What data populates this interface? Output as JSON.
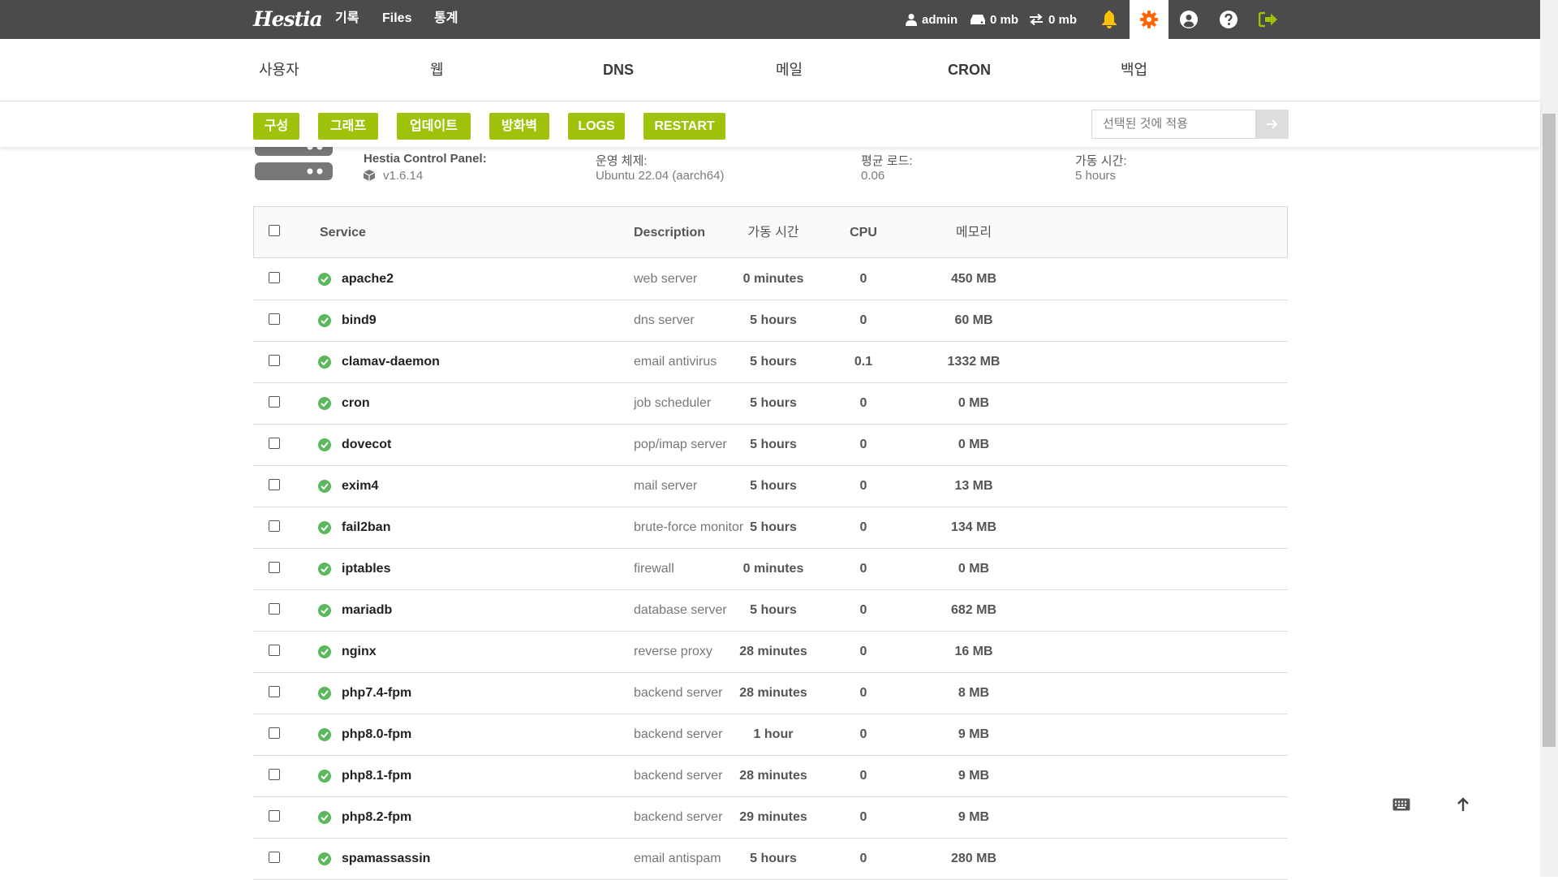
{
  "topbar": {
    "logo": "Hestia",
    "nav": [
      "기록",
      "Files",
      "통계"
    ],
    "user": "admin",
    "disk": "0 mb",
    "bandwidth": "0 mb",
    "colors": {
      "bar": "#4b4b4b",
      "bell": "#ffc107",
      "gear": "#ff6701",
      "logout": "#9ec30a"
    }
  },
  "mainnav": {
    "tabs": [
      "사용자",
      "웹",
      "DNS",
      "메일",
      "CRON",
      "백업"
    ]
  },
  "toolbar": {
    "buttons": [
      "구성",
      "그래프",
      "업데이트",
      "방화벽",
      "LOGS",
      "RESTART"
    ],
    "apply_placeholder": "선택된 것에 적용",
    "accent": "#9ec30a"
  },
  "server": {
    "panel_label": "Hestia Control Panel:",
    "panel_version": "v1.6.14",
    "os_label": "운영 체제:",
    "os_value": "Ubuntu 22.04 (aarch64)",
    "load_label": "평균 로드:",
    "load_value": "0.06",
    "uptime_label": "가동 시간:",
    "uptime_value": "5 hours"
  },
  "table": {
    "headers": {
      "service": "Service",
      "description": "Description",
      "uptime": "가동 시간",
      "cpu": "CPU",
      "memory": "메모리"
    },
    "rows": [
      {
        "name": "apache2",
        "desc": "web server",
        "uptime": "0 minutes",
        "cpu": "0",
        "mem": "450 MB"
      },
      {
        "name": "bind9",
        "desc": "dns server",
        "uptime": "5 hours",
        "cpu": "0",
        "mem": "60 MB"
      },
      {
        "name": "clamav-daemon",
        "desc": "email antivirus",
        "uptime": "5 hours",
        "cpu": "0.1",
        "mem": "1332 MB"
      },
      {
        "name": "cron",
        "desc": "job scheduler",
        "uptime": "5 hours",
        "cpu": "0",
        "mem": "0 MB"
      },
      {
        "name": "dovecot",
        "desc": "pop/imap server",
        "uptime": "5 hours",
        "cpu": "0",
        "mem": "0 MB"
      },
      {
        "name": "exim4",
        "desc": "mail server",
        "uptime": "5 hours",
        "cpu": "0",
        "mem": "13 MB"
      },
      {
        "name": "fail2ban",
        "desc": "brute-force monitor",
        "uptime": "5 hours",
        "cpu": "0",
        "mem": "134 MB"
      },
      {
        "name": "iptables",
        "desc": "firewall",
        "uptime": "0 minutes",
        "cpu": "0",
        "mem": "0 MB"
      },
      {
        "name": "mariadb",
        "desc": "database server",
        "uptime": "5 hours",
        "cpu": "0",
        "mem": "682 MB"
      },
      {
        "name": "nginx",
        "desc": "reverse proxy",
        "uptime": "28 minutes",
        "cpu": "0",
        "mem": "16 MB"
      },
      {
        "name": "php7.4-fpm",
        "desc": "backend server",
        "uptime": "28 minutes",
        "cpu": "0",
        "mem": "8 MB"
      },
      {
        "name": "php8.0-fpm",
        "desc": "backend server",
        "uptime": "1 hour",
        "cpu": "0",
        "mem": "9 MB"
      },
      {
        "name": "php8.1-fpm",
        "desc": "backend server",
        "uptime": "28 minutes",
        "cpu": "0",
        "mem": "9 MB"
      },
      {
        "name": "php8.2-fpm",
        "desc": "backend server",
        "uptime": "29 minutes",
        "cpu": "0",
        "mem": "9 MB"
      },
      {
        "name": "spamassassin",
        "desc": "email antispam",
        "uptime": "5 hours",
        "cpu": "0",
        "mem": "280 MB"
      }
    ]
  }
}
